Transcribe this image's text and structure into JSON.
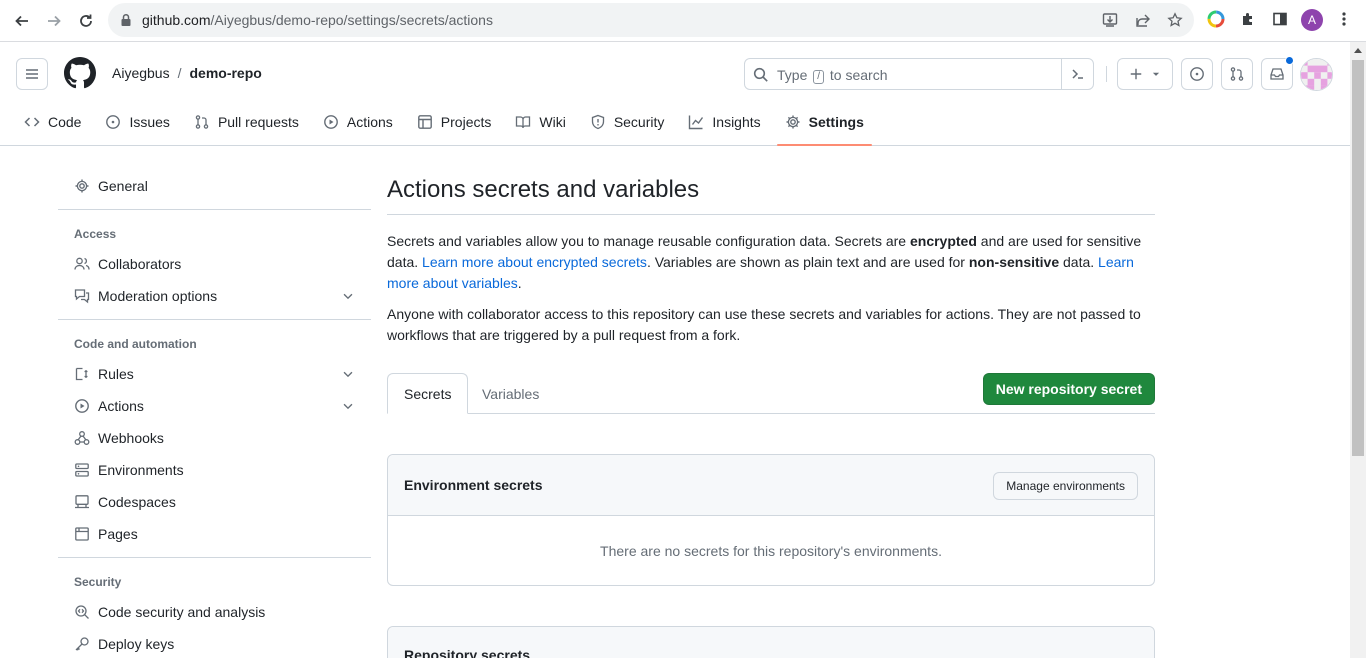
{
  "browser": {
    "url_host": "github.com",
    "url_path": "/Aiyegbus/demo-repo/settings/secrets/actions",
    "profile_initial": "A"
  },
  "header": {
    "owner": "Aiyegbus",
    "separator": "/",
    "repo": "demo-repo",
    "search_prefix": "Type",
    "search_key": "/",
    "search_suffix": "to search"
  },
  "repo_nav": [
    {
      "label": "Code",
      "icon": "code-icon"
    },
    {
      "label": "Issues",
      "icon": "issue-icon"
    },
    {
      "label": "Pull requests",
      "icon": "pull-request-icon"
    },
    {
      "label": "Actions",
      "icon": "play-icon"
    },
    {
      "label": "Projects",
      "icon": "table-icon"
    },
    {
      "label": "Wiki",
      "icon": "book-icon"
    },
    {
      "label": "Security",
      "icon": "shield-icon"
    },
    {
      "label": "Insights",
      "icon": "graph-icon"
    },
    {
      "label": "Settings",
      "icon": "gear-icon",
      "active": true
    }
  ],
  "sidebar": {
    "general": "General",
    "access_heading": "Access",
    "collaborators": "Collaborators",
    "moderation": "Moderation options",
    "code_automation_heading": "Code and automation",
    "rules": "Rules",
    "actions": "Actions",
    "webhooks": "Webhooks",
    "environments": "Environments",
    "codespaces": "Codespaces",
    "pages": "Pages",
    "security_heading": "Security",
    "code_security": "Code security and analysis",
    "deploy_keys": "Deploy keys"
  },
  "main": {
    "title": "Actions secrets and variables",
    "p1_a": "Secrets and variables allow you to manage reusable configuration data. Secrets are ",
    "p1_b": "encrypted",
    "p1_c": " and are used for sensitive data. ",
    "p1_link1": "Learn more about encrypted secrets",
    "p1_d": ". Variables are shown as plain text and are used for ",
    "p1_e": "non-sensitive",
    "p1_f": " data. ",
    "p1_link2": "Learn more about variables",
    "p1_g": ".",
    "p2": "Anyone with collaborator access to this repository can use these secrets and variables for actions. They are not passed to workflows that are triggered by a pull request from a fork.",
    "tab_secrets": "Secrets",
    "tab_variables": "Variables",
    "new_secret_button": "New repository secret",
    "env_secrets_title": "Environment secrets",
    "manage_env_button": "Manage environments",
    "env_empty": "There are no secrets for this repository's environments.",
    "repo_secrets_title": "Repository secrets"
  },
  "colors": {
    "green": "#1f883d",
    "link": "#0969da",
    "active_underline": "#fd8c73"
  }
}
